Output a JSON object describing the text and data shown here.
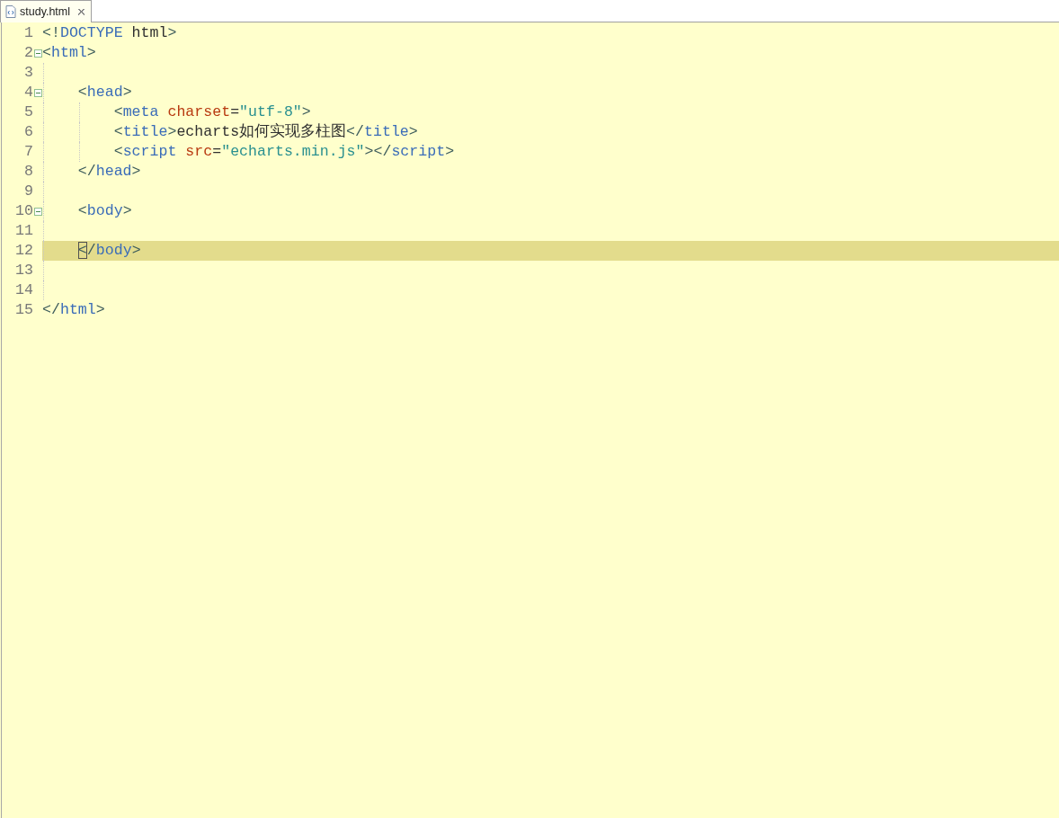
{
  "tabs": [
    {
      "label": "study.html",
      "selected": true
    }
  ],
  "lines": [
    {
      "number": "1",
      "tokens": [
        {
          "kind": "bracket",
          "text": "<!"
        },
        {
          "kind": "tag",
          "text": "DOCTYPE"
        },
        {
          "kind": "text",
          "text": " html"
        },
        {
          "kind": "bracket",
          "text": ">"
        }
      ]
    },
    {
      "number": "2",
      "expanded": true,
      "tokens": [
        {
          "kind": "bracket",
          "text": "<"
        },
        {
          "kind": "tag",
          "text": "html"
        },
        {
          "kind": "bracket",
          "text": ">"
        }
      ]
    },
    {
      "number": "3"
    },
    {
      "number": "4",
      "expanded": true,
      "tokens": [
        {
          "kind": "bracket",
          "text": "    <"
        },
        {
          "kind": "tag",
          "text": "head"
        },
        {
          "kind": "bracket",
          "text": ">"
        }
      ]
    },
    {
      "number": "5",
      "tokens": [
        {
          "kind": "bracket",
          "text": "        <"
        },
        {
          "kind": "tag",
          "text": "meta"
        },
        {
          "kind": "attr",
          "text": " charset"
        },
        {
          "kind": "text",
          "text": "="
        },
        {
          "kind": "value",
          "text": "\"utf-8\""
        },
        {
          "kind": "bracket",
          "text": ">"
        }
      ]
    },
    {
      "number": "6",
      "tokens": [
        {
          "kind": "bracket",
          "text": "        <"
        },
        {
          "kind": "tag",
          "text": "title"
        },
        {
          "kind": "bracket",
          "text": ">"
        },
        {
          "kind": "text",
          "text": "echarts如何实现多柱图"
        },
        {
          "kind": "bracket",
          "text": "</"
        },
        {
          "kind": "tag",
          "text": "title"
        },
        {
          "kind": "bracket",
          "text": ">"
        }
      ]
    },
    {
      "number": "7",
      "tokens": [
        {
          "kind": "bracket",
          "text": "        <"
        },
        {
          "kind": "tag",
          "text": "script"
        },
        {
          "kind": "attr",
          "text": " src"
        },
        {
          "kind": "text",
          "text": "="
        },
        {
          "kind": "value",
          "text": "\"echarts.min.js\""
        },
        {
          "kind": "bracket",
          "text": "></"
        },
        {
          "kind": "tag",
          "text": "script"
        },
        {
          "kind": "bracket",
          "text": ">"
        }
      ]
    },
    {
      "number": "8",
      "tokens": [
        {
          "kind": "bracket",
          "text": "    </"
        },
        {
          "kind": "tag",
          "text": "head"
        },
        {
          "kind": "bracket",
          "text": ">"
        }
      ]
    },
    {
      "number": "9"
    },
    {
      "number": "10",
      "expanded": true,
      "tokens": [
        {
          "kind": "bracket",
          "text": "    <"
        },
        {
          "kind": "tag",
          "text": "body"
        },
        {
          "kind": "bracket",
          "text": ">"
        }
      ]
    },
    {
      "number": "11"
    },
    {
      "number": "12",
      "current": true,
      "tokens": [
        {
          "kind": "bracket",
          "text": "    <",
          "cursor": true
        },
        {
          "kind": "bracket",
          "text": "/"
        },
        {
          "kind": "tag",
          "text": "body"
        },
        {
          "kind": "bracket",
          "text": ">"
        }
      ]
    },
    {
      "number": "13"
    },
    {
      "number": "14"
    },
    {
      "number": "15",
      "tokens": [
        {
          "kind": "bracket",
          "text": "</"
        },
        {
          "kind": "tag",
          "text": "html"
        },
        {
          "kind": "bracket",
          "text": ">"
        }
      ]
    }
  ]
}
